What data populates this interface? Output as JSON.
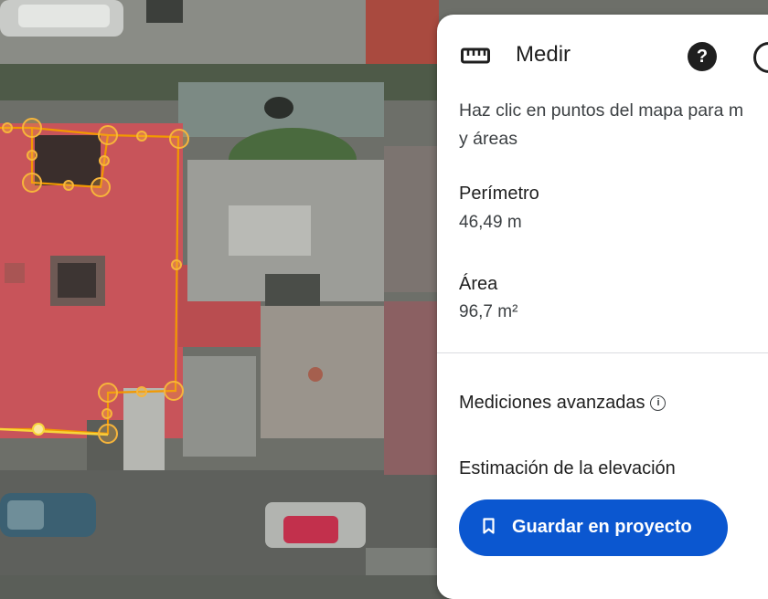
{
  "panel": {
    "title": "Medir",
    "icons": {
      "title": "ruler-icon",
      "help": "help-icon",
      "more": "more-options-icon"
    },
    "instructions_line1": "Haz clic en puntos del mapa para m",
    "instructions_line2": "y áreas",
    "perimeter_label": "Perímetro",
    "perimeter_value": "46,49 m",
    "area_label": "Área",
    "area_value": "96,7 m²",
    "advanced_label": "Mediciones avanzadas",
    "elevation_label": "Estimación de la elevación",
    "save_button_label": "Guardar en proyecto",
    "accent_color": "#0b57d0"
  },
  "map": {
    "view": "satellite",
    "measure_line_color": "#f29900"
  }
}
